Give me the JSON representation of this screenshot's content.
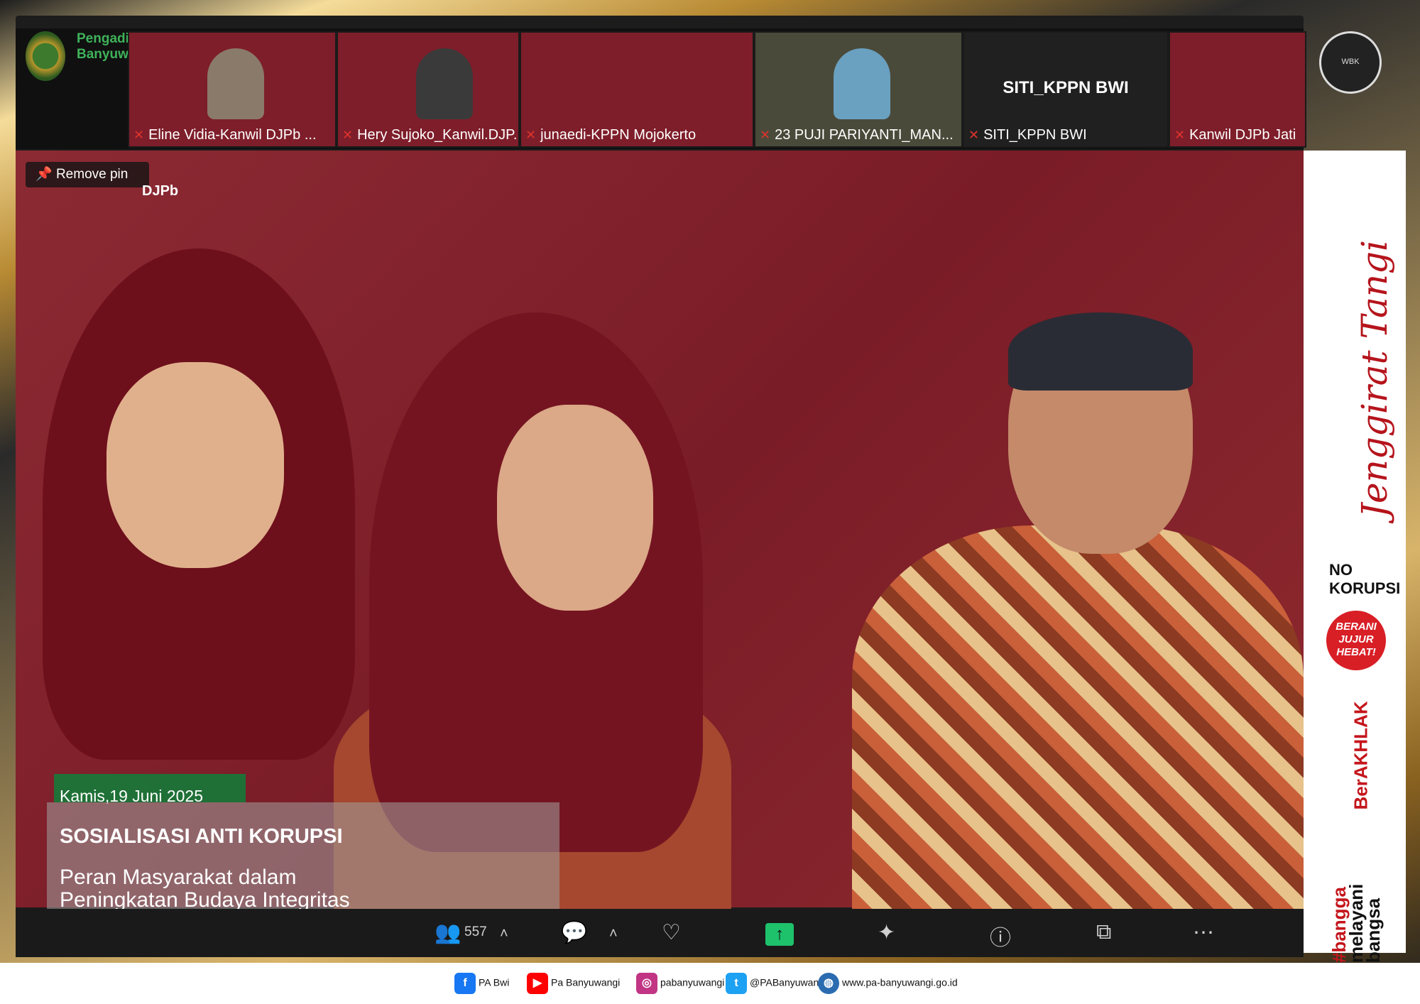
{
  "header": {
    "org_name_line1": "Pengadilan Agama",
    "org_name_line2": "Banyuwangi"
  },
  "participants": [
    {
      "name": "Eline Vidia-Kanwil DJPb ...",
      "muted": true
    },
    {
      "name": "Hery Sujoko_Kanwil.DJP...",
      "muted": true
    },
    {
      "name": "junaedi-KPPN Mojokerto",
      "muted": true
    },
    {
      "name": "23 PUJI PARIYANTI_MAN...",
      "muted": true
    },
    {
      "name": "SITI_KPPN BWI",
      "muted": true,
      "video_off_label": "SITI_KPPN BWI"
    },
    {
      "name": "Kanwil DJPb Jati",
      "muted": true
    }
  ],
  "main": {
    "remove_pin_label": "Remove pin",
    "brand_text": "DJPb"
  },
  "caption": {
    "date": "Kamis,19 Juni 2025",
    "title": "SOSIALISASI ANTI KORUPSI",
    "subtitle_line1": "Peran Masyarakat dalam",
    "subtitle_line2": "Peningkatan Budaya Integritas"
  },
  "toolbar": {
    "participants_count": "557"
  },
  "side_panel": {
    "slogan": "Jenggirat Tangi",
    "no_korupsi": "NO KORUPSI",
    "berani_line1": "BERANI",
    "berani_line2": "JUJUR",
    "berani_line3": "HEBAT!",
    "berakhlak": "BerAKHLAK",
    "bangga_line1": "#bangga",
    "bangga_line2": "melayani",
    "bangga_line3": "bangsa"
  },
  "footer": {
    "facebook": "PA Bwi",
    "youtube": "Pa Banyuwangi",
    "instagram": "pabanyuwangi",
    "twitter": "@PABanyuwangi",
    "website": "www.pa-banyuwangi.go.id"
  },
  "colors": {
    "video_bg": "#7a1c27",
    "gold": "#c9993f",
    "accent_green": "#1ec26b",
    "brand_red": "#c4161c"
  }
}
